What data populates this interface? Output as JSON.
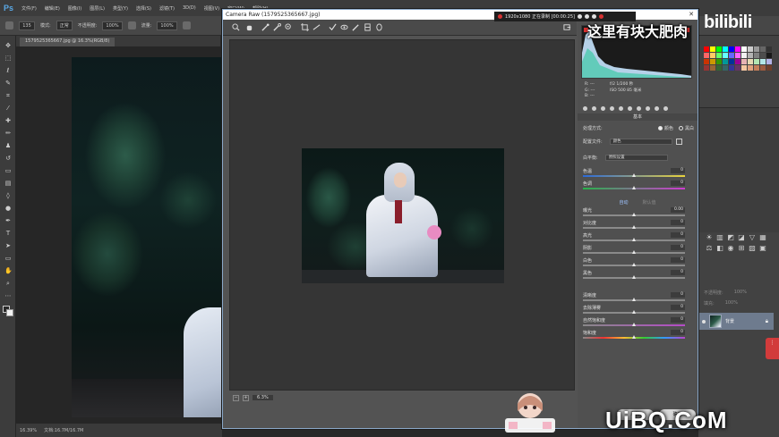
{
  "app": {
    "logo": "Ps",
    "menus": [
      "文件(F)",
      "编辑(E)",
      "图像(I)",
      "图层(L)",
      "类型(Y)",
      "选择(S)",
      "滤镜(T)",
      "3D(D)",
      "视图(V)",
      "窗口(W)",
      "帮助(H)"
    ],
    "options": {
      "size_value": "135",
      "mode_label": "模式:",
      "mode_value": "正常",
      "opacity_label": "不透明度:",
      "opacity_value": "100%",
      "flow_label": "流量:",
      "flow_value": "100%"
    },
    "document_tab": "1579525365667.jpg @ 16.3%(RGB/8)",
    "status_zoom": "16.39%",
    "status_doc": "文档:16.7M/16.7M"
  },
  "overlay": {
    "caption": "这里有块大肥肉",
    "bilibili": "bilibili",
    "recorder_text": "1920x1080 正在录制 [00:00:25]",
    "site_watermark": "UiBQ.CoM"
  },
  "camera_raw": {
    "title": "Camera Raw (1579525365667.jpg)",
    "zoom_value": "6.3%",
    "rgb": [
      {
        "label": "R:",
        "value": "---"
      },
      {
        "label": "G:",
        "value": "---"
      },
      {
        "label": "B:",
        "value": "---"
      }
    ],
    "exif": [
      "f/2   1/200 秒",
      "ISO 500   85 毫米"
    ],
    "panel_title": "基本",
    "treatment_label": "处理方式:",
    "treatment_color": "颜色",
    "treatment_bw": "黑白",
    "profile_label": "配置文件:",
    "profile_value": "颜色",
    "wb_label": "白平衡:",
    "wb_value": "原照设置",
    "auto_label": "自动",
    "default_label": "默认值",
    "sliders_top": [
      {
        "label": "色温",
        "value": "0"
      },
      {
        "label": "色调",
        "value": "0"
      }
    ],
    "sliders": [
      {
        "label": "曝光",
        "value": "0.00"
      },
      {
        "label": "对比度",
        "value": "0"
      },
      {
        "label": "高光",
        "value": "0"
      },
      {
        "label": "阴影",
        "value": "0"
      },
      {
        "label": "白色",
        "value": "0"
      },
      {
        "label": "黑色",
        "value": "0"
      },
      {
        "label": "清晰度",
        "value": "0"
      },
      {
        "label": "去除薄雾",
        "value": "0"
      },
      {
        "label": "自然饱和度",
        "value": "0"
      },
      {
        "label": "饱和度",
        "value": "0"
      }
    ],
    "cancel_label": "取消",
    "ok_label": "确定"
  },
  "layers": {
    "dim_rows": [
      {
        "a": "不透明度:",
        "b": "100%"
      },
      {
        "a": "填充:",
        "b": "100%"
      }
    ],
    "active_layer": "背景"
  },
  "colors": {
    "accent": "#5aa9e6",
    "layer_selected": "#6e7b8e",
    "histogram": "#c7e6ff"
  }
}
